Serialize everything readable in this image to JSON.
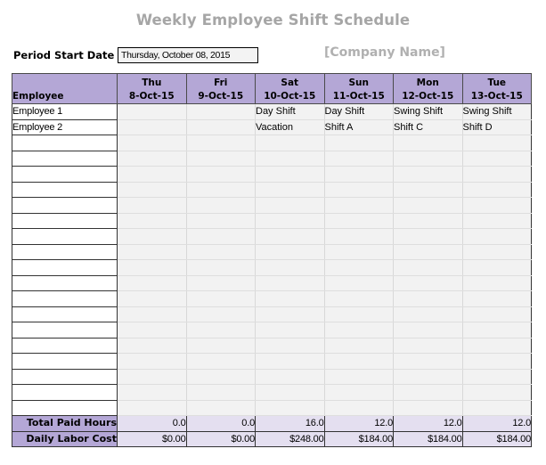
{
  "title": "Weekly Employee Shift Schedule",
  "period_start": {
    "label": "Period Start Date",
    "value": "Thursday, October 08, 2015"
  },
  "company_name": "[Company Name]",
  "colors": {
    "header_bg": "#b4a7d6",
    "total_value_bg": "#e4dff0",
    "day_shift": "#b6a889",
    "swing_shift": "#8eb3df",
    "vacation": "#a8da8c",
    "shift_a": "#d9eccd",
    "shift_c": "#aedaea",
    "shift_d": "#f7c7a0"
  },
  "table": {
    "employee_header": "Employee",
    "days": [
      {
        "day": "Thu",
        "date": "8-Oct-15"
      },
      {
        "day": "Fri",
        "date": "9-Oct-15"
      },
      {
        "day": "Sat",
        "date": "10-Oct-15"
      },
      {
        "day": "Sun",
        "date": "11-Oct-15"
      },
      {
        "day": "Mon",
        "date": "12-Oct-15"
      },
      {
        "day": "Tue",
        "date": "13-Oct-15"
      }
    ],
    "rows": [
      {
        "employee": "Employee 1",
        "shifts": [
          {
            "text": "",
            "type": ""
          },
          {
            "text": "",
            "type": ""
          },
          {
            "text": "Day Shift",
            "type": "day"
          },
          {
            "text": "Day Shift",
            "type": "day"
          },
          {
            "text": "Swing Shift",
            "type": "swing"
          },
          {
            "text": "Swing Shift",
            "type": "swing"
          }
        ]
      },
      {
        "employee": "Employee 2",
        "shifts": [
          {
            "text": "",
            "type": ""
          },
          {
            "text": "",
            "type": ""
          },
          {
            "text": "Vacation",
            "type": "vac"
          },
          {
            "text": "Shift A",
            "type": "a"
          },
          {
            "text": "Shift C",
            "type": "c"
          },
          {
            "text": "Shift  D",
            "type": "d"
          }
        ]
      }
    ],
    "empty_row_count": 18,
    "totals": [
      {
        "label": "Total Paid Hours",
        "values": [
          "0.0",
          "0.0",
          "16.0",
          "12.0",
          "12.0",
          "12.0"
        ]
      },
      {
        "label": "Daily Labor Cost",
        "values": [
          "$0.00",
          "$0.00",
          "$248.00",
          "$184.00",
          "$184.00",
          "$184.00"
        ]
      }
    ]
  }
}
